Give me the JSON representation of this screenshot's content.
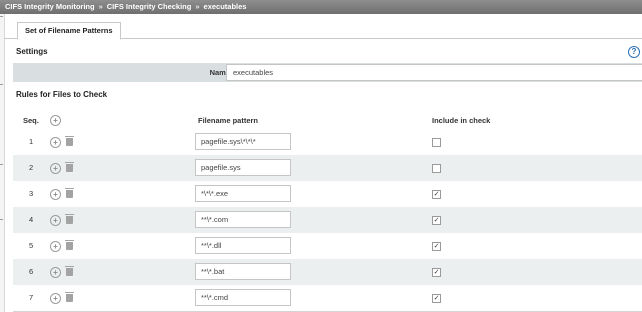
{
  "breadcrumb": {
    "items": [
      "CIFS Integrity Monitoring",
      "CIFS Integrity Checking",
      "executables"
    ],
    "separator": "»"
  },
  "tabs": [
    {
      "label": "Set of Filename Patterns"
    }
  ],
  "settings": {
    "heading": "Settings",
    "help_icon": "?",
    "name_label": "Name",
    "name_value": "executables"
  },
  "rules": {
    "heading": "Rules for Files to Check",
    "columns": {
      "seq": "Seq.",
      "pattern": "Filename pattern",
      "include": "Include in check"
    },
    "rows": [
      {
        "seq": "1",
        "pattern": "pagefile.sys\\*\\*\\*",
        "include": false
      },
      {
        "seq": "2",
        "pattern": "pagefile.sys",
        "include": false
      },
      {
        "seq": "3",
        "pattern": "*\\*\\*.exe",
        "include": true
      },
      {
        "seq": "4",
        "pattern": "**\\*.com",
        "include": true
      },
      {
        "seq": "5",
        "pattern": "**\\*.dll",
        "include": true
      },
      {
        "seq": "6",
        "pattern": "**\\*.bat",
        "include": true
      },
      {
        "seq": "7",
        "pattern": "**\\*.cmd",
        "include": true
      }
    ]
  },
  "icons": {
    "add": "plus-circle-icon",
    "delete": "trash-icon",
    "checkmark": "✓"
  }
}
